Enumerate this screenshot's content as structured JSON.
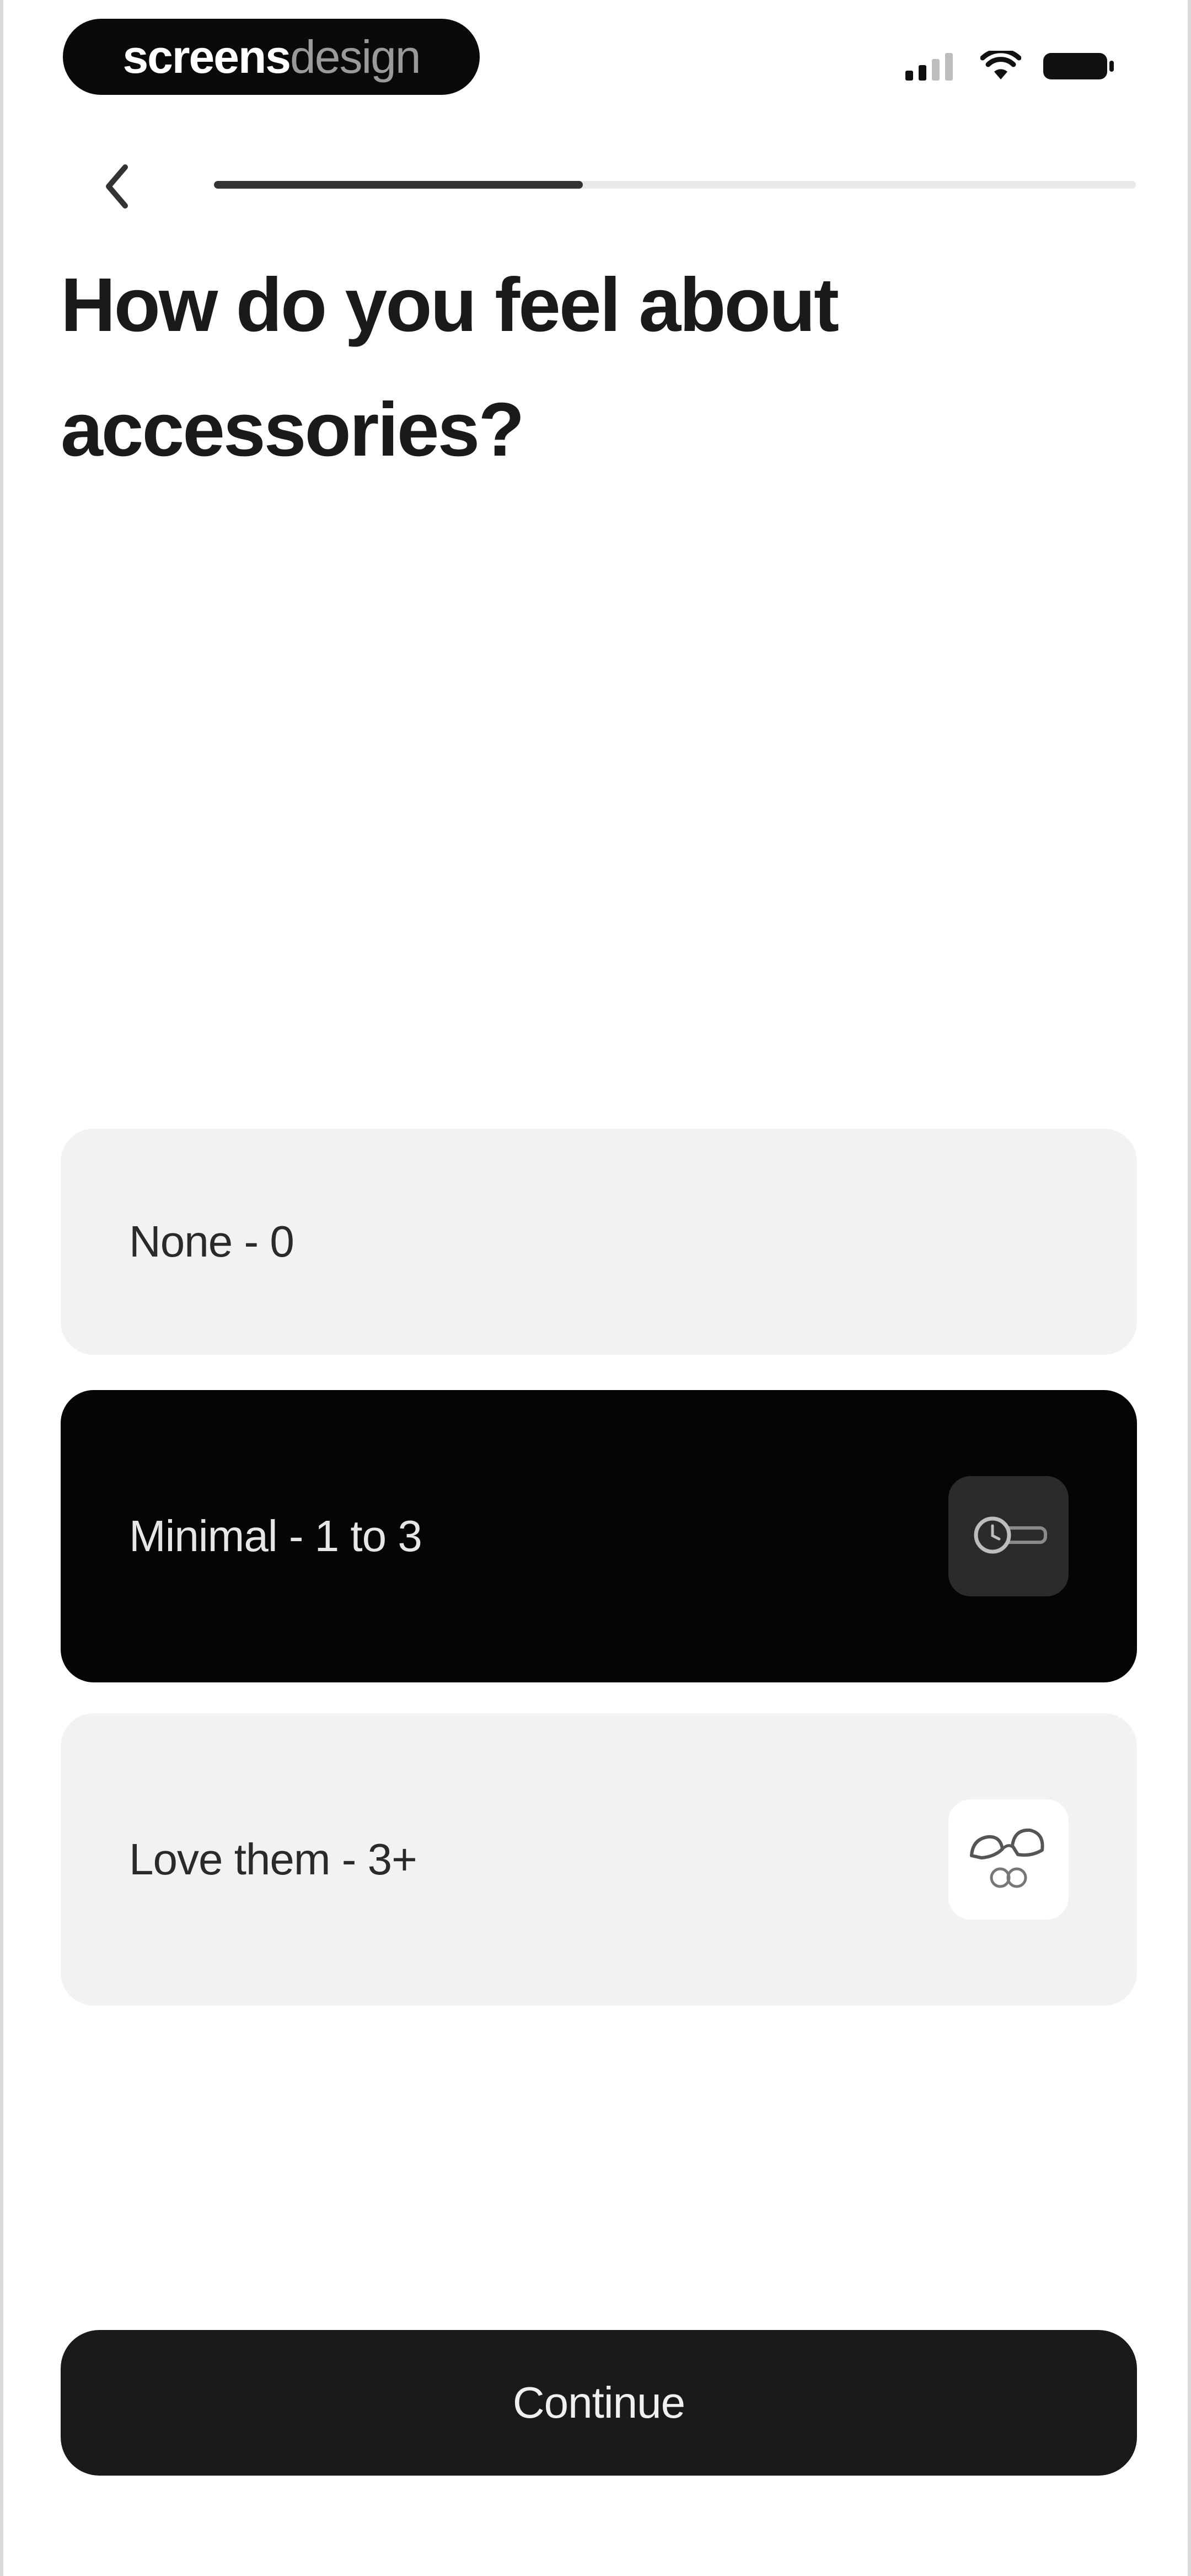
{
  "brand": {
    "part_strong": "screens",
    "part_light": "design"
  },
  "status_bar": {
    "icons": [
      "cellular-signal-icon",
      "wifi-icon",
      "battery-icon"
    ]
  },
  "navigation": {
    "back_icon": "chevron-left-icon",
    "progress_fraction": 0.4
  },
  "question": {
    "title": "How do you feel about accessories?"
  },
  "options": [
    {
      "label": "None - 0",
      "selected": false,
      "icon": ""
    },
    {
      "label": "Minimal - 1 to 3",
      "selected": true,
      "icon": "watch-icon"
    },
    {
      "label": "Love them - 3+",
      "selected": false,
      "icon": "sunglasses-icon"
    }
  ],
  "actions": {
    "continue_label": "Continue"
  },
  "colors": {
    "selected_background": "#050505",
    "option_background": "#f2f2f2",
    "button_background": "#1a1a1a"
  }
}
